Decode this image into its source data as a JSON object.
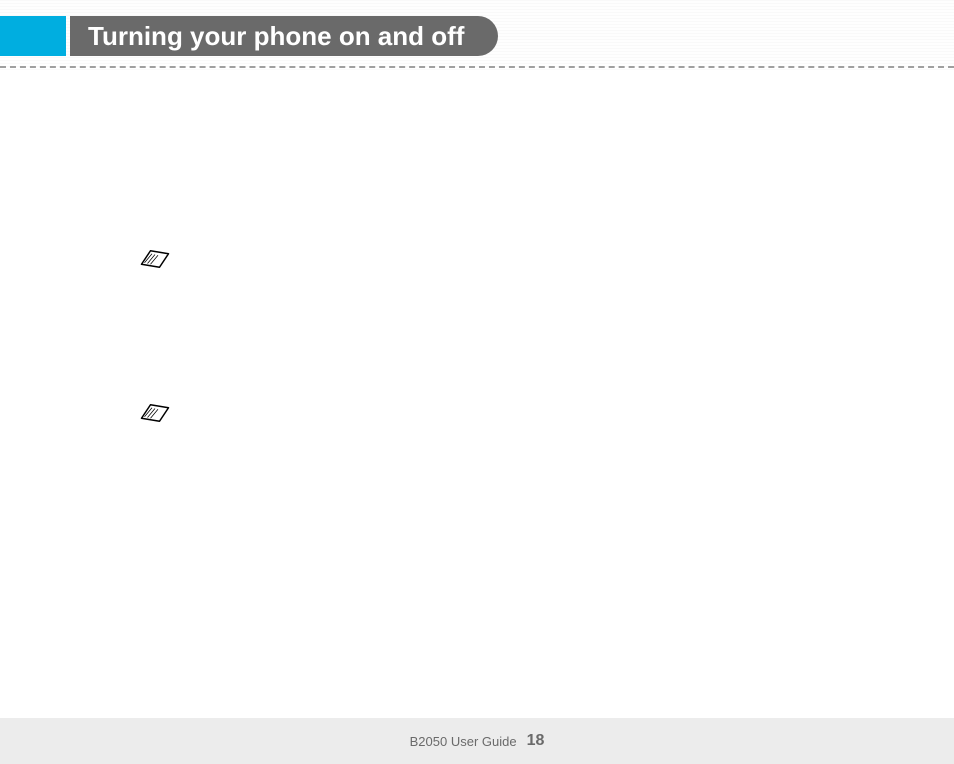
{
  "header": {
    "title": "Turning your phone on and off"
  },
  "footer": {
    "guide_label": "B2050 User Guide",
    "page_number": "18"
  }
}
